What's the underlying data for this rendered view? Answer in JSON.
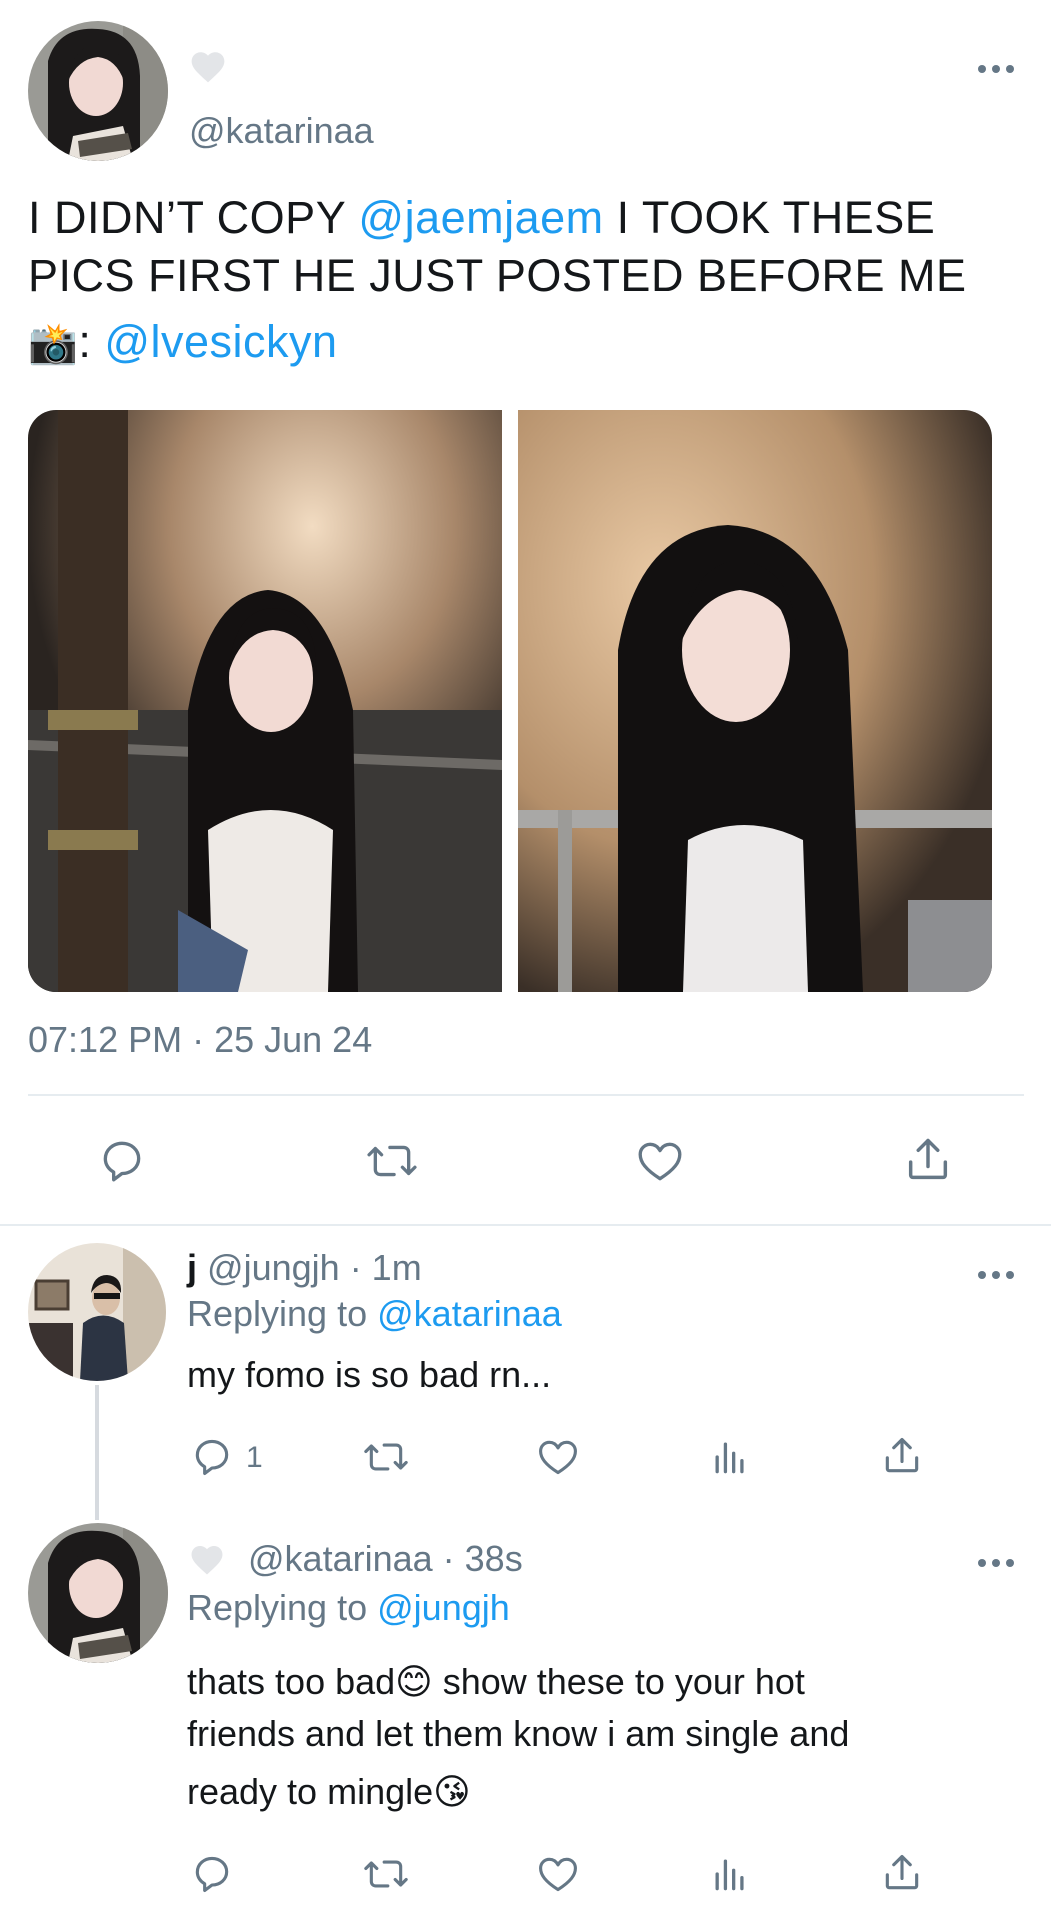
{
  "main_tweet": {
    "handle": "@katarinaa",
    "text_part1": "I DIDN’T COPY ",
    "mention1": "@jaemjaem",
    "text_part2": " I TOOK THESE PICS FIRST HE JUST POSTED BEFORE ME",
    "photo_credit_emoji": "📸",
    "photo_credit_colon": ":",
    "mention2": "@lvesickyn",
    "timestamp": "07:12 PM · 25 Jun 24"
  },
  "reply1": {
    "display_name": "j",
    "handle": "@jungjh",
    "time": "· 1m",
    "replying_prefix": "Replying to",
    "replying_to": "@katarinaa",
    "text": "my fomo is so bad rn...",
    "reply_count": "1"
  },
  "reply2": {
    "handle": "@katarinaa",
    "time": "· 38s",
    "replying_prefix": "Replying to",
    "replying_to": "@jungjh",
    "text_line1a": "thats too bad",
    "emoji1": "😊",
    "text_line1b": " show these to your hot",
    "text_line2": "friends and let them know i am single and",
    "text_line3": "ready to mingle",
    "emoji2": "😘"
  },
  "icons": {
    "more": "more-icon",
    "reply": "reply-icon",
    "retweet": "retweet-icon",
    "like": "like-icon",
    "share": "share-icon",
    "analytics": "analytics-icon",
    "verified_heart": "heart-badge-icon"
  },
  "colors": {
    "link": "#1d9bf0",
    "secondary": "#657786",
    "divider": "#e6ecf0"
  }
}
